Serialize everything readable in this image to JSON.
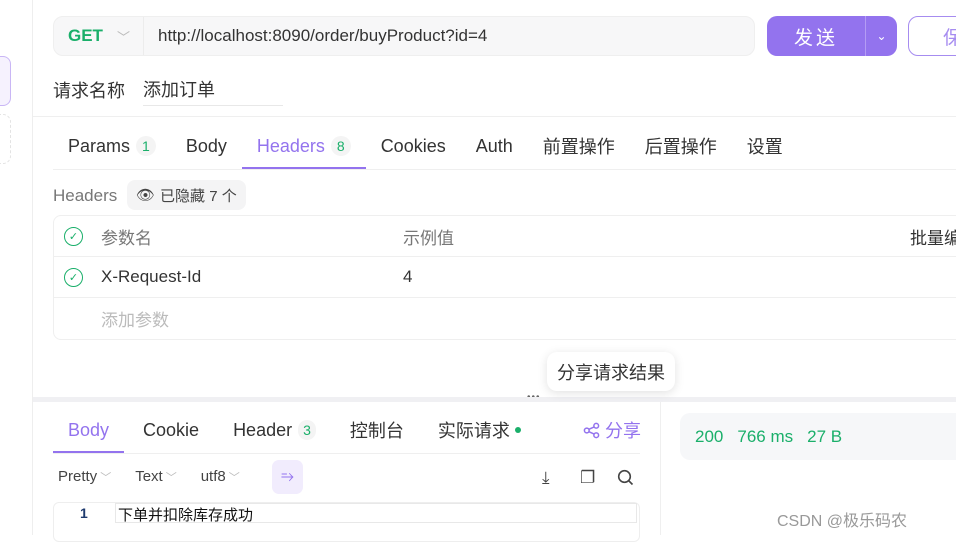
{
  "request": {
    "method": "GET",
    "url": "http://localhost:8090/order/buyProduct?id=4",
    "send_label": "发送",
    "save_label": "保",
    "name_label": "请求名称",
    "name_value": "添加订单"
  },
  "req_tabs": [
    {
      "label": "Params",
      "badge": "1"
    },
    {
      "label": "Body"
    },
    {
      "label": "Headers",
      "badge": "8",
      "active": true
    },
    {
      "label": "Cookies"
    },
    {
      "label": "Auth"
    },
    {
      "label": "前置操作"
    },
    {
      "label": "后置操作"
    },
    {
      "label": "设置"
    }
  ],
  "headers_section": {
    "label": "Headers",
    "hidden_label": "已隐藏 7 个",
    "columns": {
      "name": "参数名",
      "example": "示例值",
      "bulk_edit": "批量编"
    },
    "rows": [
      {
        "name": "X-Request-Id",
        "value": "4"
      }
    ],
    "add_placeholder": "添加参数"
  },
  "tooltip": "分享请求结果",
  "resp_tabs": [
    {
      "label": "Body",
      "active": true
    },
    {
      "label": "Cookie"
    },
    {
      "label": "Header",
      "badge": "3"
    },
    {
      "label": "控制台"
    },
    {
      "label": "实际请求"
    }
  ],
  "share_label": "分享",
  "body_options": {
    "format": "Pretty",
    "type": "Text",
    "encoding": "utf8"
  },
  "body_lines": [
    {
      "number": "1",
      "text": "下单并扣除库存成功"
    }
  ],
  "status": {
    "code": "200",
    "time": "766 ms",
    "size": "27 B"
  },
  "watermark": "CSDN @极乐码农",
  "colors": {
    "accent": "#9373ee",
    "success": "#1aaf6a"
  }
}
